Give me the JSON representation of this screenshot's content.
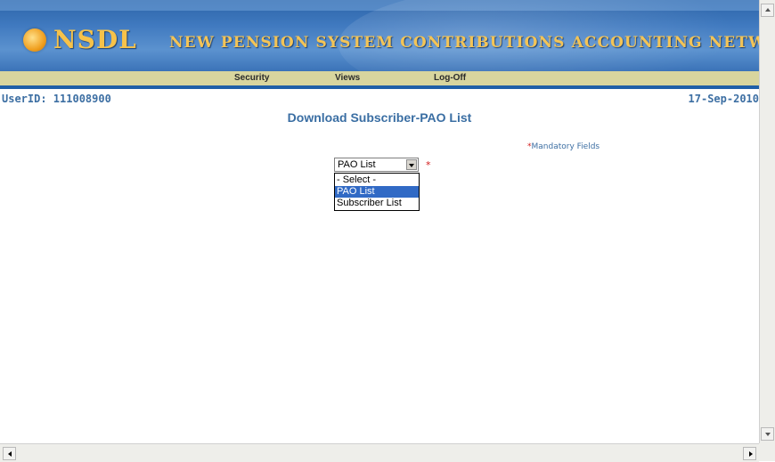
{
  "banner": {
    "logo_text": "NSDL",
    "title": "NEW PENSION SYSTEM CONTRIBUTIONS ACCOUNTING NETWORK"
  },
  "nav": {
    "items": [
      {
        "label": "Security"
      },
      {
        "label": "Views"
      },
      {
        "label": "Log-Off"
      }
    ]
  },
  "info": {
    "userid": "UserID: 111008900",
    "date": "17-Sep-2010"
  },
  "page": {
    "title": "Download Subscriber-PAO List",
    "mandatory_star": "*",
    "mandatory_text": "Mandatory Fields",
    "required_star": "*"
  },
  "list_select": {
    "selected_value": "PAO List",
    "options": [
      {
        "label": "- Select -"
      },
      {
        "label": "PAO List"
      },
      {
        "label": "Subscriber List"
      }
    ],
    "highlighted_option": "PAO List"
  },
  "icons": {
    "logo": "nsdl-logo-icon",
    "dropdown": "chevron-down-icon",
    "cursor": "mouse-pointer-icon"
  },
  "colors": {
    "banner_blue": "#3f79bf",
    "nav_bar": "#d8d59e",
    "accent_blue": "#3a6ea3",
    "required_red": "#d21b1b",
    "selection_blue": "#316ac5"
  }
}
